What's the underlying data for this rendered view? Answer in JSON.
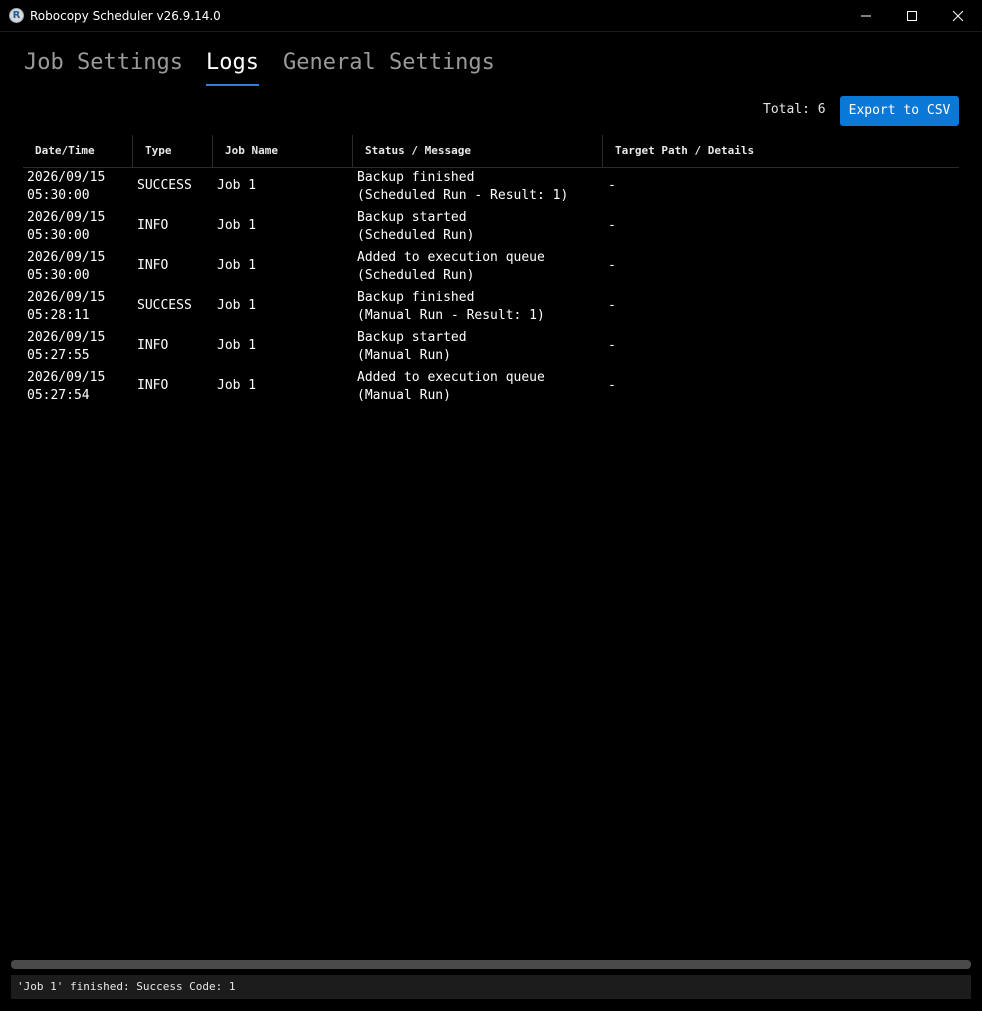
{
  "window": {
    "title": "Robocopy Scheduler v26.9.14.0",
    "icon_letter": "R"
  },
  "tabs": [
    {
      "label": "Job Settings",
      "active": false
    },
    {
      "label": "Logs",
      "active": true
    },
    {
      "label": "General Settings",
      "active": false
    }
  ],
  "toolbar": {
    "total_label": "Total: 6",
    "export_label": "Export to CSV"
  },
  "table": {
    "headers": [
      "Date/Time",
      "Type",
      "Job Name",
      "Status / Message",
      "Target Path / Details"
    ],
    "rows": [
      {
        "date": "2026/09/15",
        "time": "05:30:00",
        "type": "SUCCESS",
        "job": "Job 1",
        "msg1": "Backup finished",
        "msg2": "(Scheduled Run - Result: 1)",
        "target": "-"
      },
      {
        "date": "2026/09/15",
        "time": "05:30:00",
        "type": "INFO",
        "job": "Job 1",
        "msg1": "Backup started",
        "msg2": "(Scheduled Run)",
        "target": "-"
      },
      {
        "date": "2026/09/15",
        "time": "05:30:00",
        "type": "INFO",
        "job": "Job 1",
        "msg1": "Added to execution queue",
        "msg2": "(Scheduled Run)",
        "target": "-"
      },
      {
        "date": "2026/09/15",
        "time": "05:28:11",
        "type": "SUCCESS",
        "job": "Job 1",
        "msg1": "Backup finished",
        "msg2": "(Manual Run - Result: 1)",
        "target": "-"
      },
      {
        "date": "2026/09/15",
        "time": "05:27:55",
        "type": "INFO",
        "job": "Job 1",
        "msg1": "Backup started",
        "msg2": "(Manual Run)",
        "target": "-"
      },
      {
        "date": "2026/09/15",
        "time": "05:27:54",
        "type": "INFO",
        "job": "Job 1",
        "msg1": "Added to execution queue",
        "msg2": "(Manual Run)",
        "target": "-"
      }
    ]
  },
  "status_bar": {
    "text": "'Job 1' finished: Success Code: 1"
  },
  "colors": {
    "accent": "#0a78d7",
    "background": "#000000"
  }
}
